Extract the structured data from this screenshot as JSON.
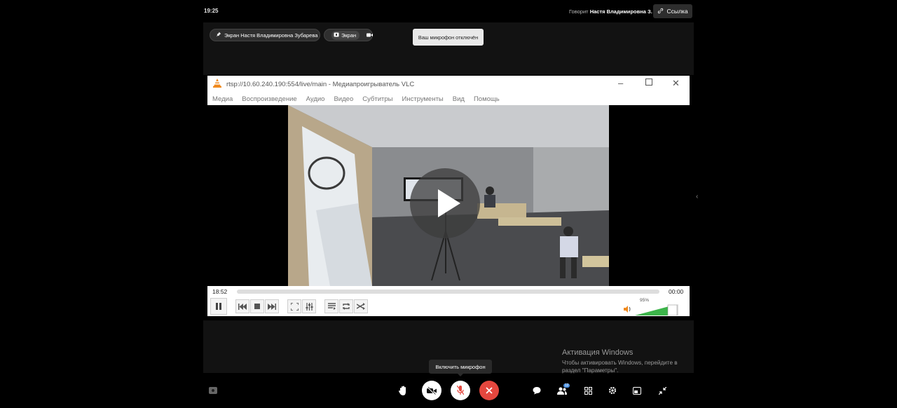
{
  "header": {
    "time": "19:25",
    "speaking_prefix": "Говорит",
    "speaking_name": "Настя Владимировна З.",
    "link_label": "Ссылка"
  },
  "stage": {
    "screen_pill_label": "Экран Настя Владимировна Зубарева",
    "screen_toggle_label": "Экран",
    "mic_off_notice": "Ваш микрофон отключён"
  },
  "vlc": {
    "title": "rtsp://10.60.240.190:554/live/main - Медиапроигрыватель VLC",
    "menu": [
      "Медиа",
      "Воспроизведение",
      "Аудио",
      "Видео",
      "Субтитры",
      "Инструменты",
      "Вид",
      "Помощь"
    ],
    "elapsed": "18:52",
    "total": "00:00",
    "volume_label": "95%",
    "volume_level": 0.95
  },
  "windows_watermark": {
    "title": "Активация Windows",
    "subtitle": "Чтобы активировать Windows, перейдите в раздел \"Параметры\"."
  },
  "toolbar": {
    "tooltip": "Включить микрофон",
    "participants_count": "12"
  },
  "colors": {
    "leave_red": "#e5473e",
    "vlc_volume_green": "#3cb44a",
    "vlc_cone_orange": "#f08a1e"
  }
}
